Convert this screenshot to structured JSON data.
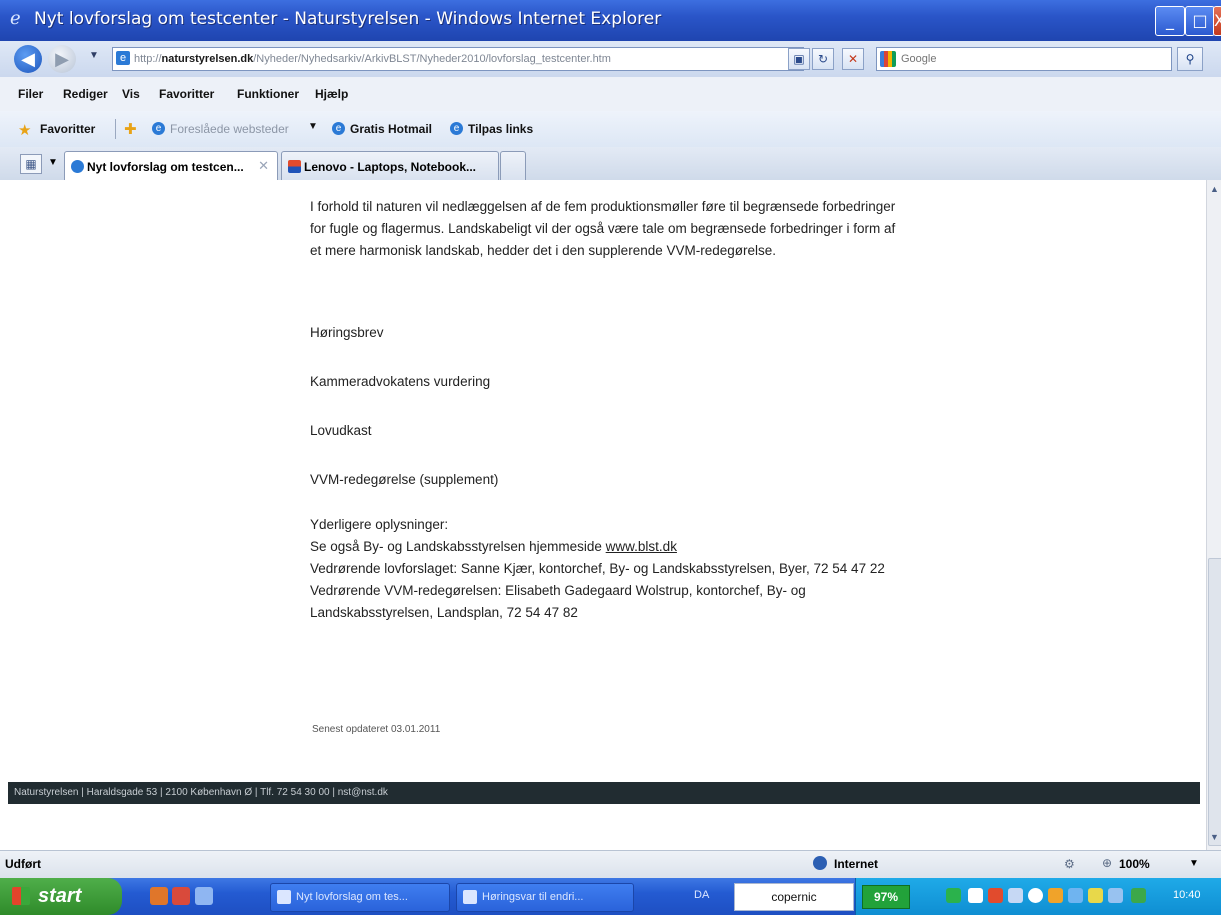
{
  "window": {
    "title": "Nyt lovforslag om testcenter - Naturstyrelsen - Windows Internet Explorer",
    "icon": "ie-logo-icon",
    "controls": {
      "minimize": "_",
      "maximize": "□",
      "close": "X"
    }
  },
  "address": {
    "url_prefix": "http://",
    "url_domain": "naturstyrelsen.dk",
    "url_path": "/Nyheder/Nyhedsarkiv/ArkivBLST/Nyheder2010/lovforslag_testcenter.htm",
    "search_placeholder": "Google",
    "refresh_icon": "refresh-icon",
    "stop_icon": "stop-icon"
  },
  "menu": [
    "Filer",
    "Rediger",
    "Vis",
    "Favoritter",
    "Funktioner",
    "Hjælp"
  ],
  "favorites_bar": {
    "favorites_label": "Favoritter",
    "suggested_sites": "Foreslåede websteder",
    "links": [
      "Gratis Hotmail",
      "Tilpas links"
    ]
  },
  "tabs": [
    {
      "label": "Nyt lovforslag om testcen...",
      "active": true
    },
    {
      "label": "Lenovo - Laptops, Notebook...",
      "active": false
    }
  ],
  "content": {
    "paragraph": "I forhold til naturen vil nedlæggelsen af de fem produktionsmøller føre til begrænsede forbedringer for fugle og flagermus. Landskabeligt vil der også være tale om begrænsede forbedringer i form af et mere harmonisk landskab, hedder det i den supplerende VVM-redegørelse.",
    "links": [
      "Høringsbrev",
      "Kammeradvokatens vurdering",
      "Lovudkast",
      "VVM-redegørelse (supplement)"
    ],
    "more_info_heading": "Yderligere oplysninger:",
    "see_also_prefix": "Se også By- og Landskabsstyrelsen hjemmeside",
    "see_also_link": "www.blst.dk",
    "contact_1": "Vedrørende lovforslaget: Sanne Kjær, kontorchef, By- og Landskabsstyrelsen, Byer, 72 54 47 22",
    "contact_2": "Vedrørende VVM-redegørelsen: Elisabeth Gadegaard Wolstrup, kontorchef, By- og Landskabsstyrelsen, Landsplan, 72 54 47 82",
    "updated": "Senest opdateret 03.01.2011",
    "footer": "Naturstyrelsen | Haraldsgade 53 | 2100 København Ø | Tlf. 72 54 30 00 | nst@nst.dk"
  },
  "statusbar": {
    "status": "Udført",
    "zone": "Internet",
    "zoom": "100%"
  },
  "taskbar": {
    "start": "start",
    "tasks": [
      "Nyt lovforslag om tes...",
      "Høringsvar til endri..."
    ],
    "language": "DA",
    "search_box": "copernic",
    "battery": "97%",
    "clock": "10:40"
  },
  "colors": {
    "titlebar": "#2a55c8",
    "taskbar": "#245bd2",
    "start_green": "#3a9a34",
    "footer_bar": "#212c31"
  }
}
